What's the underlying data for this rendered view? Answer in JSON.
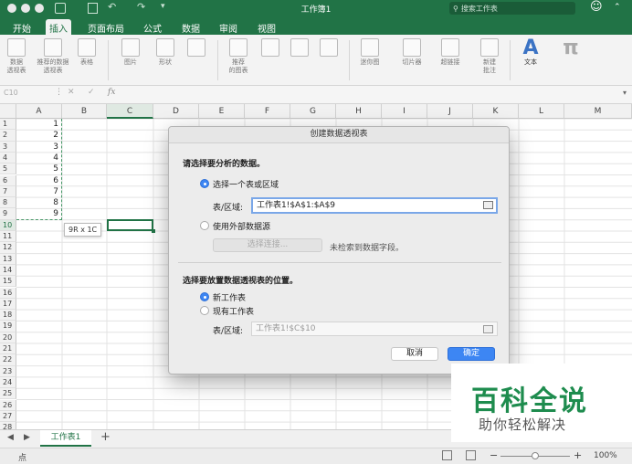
{
  "window": {
    "title": "工作簿1",
    "search_placeholder": "搜索工作表",
    "emoji": "☺"
  },
  "tabs": [
    "开始",
    "插入",
    "页面布局",
    "公式",
    "数据",
    "审阅",
    "视图"
  ],
  "ribbon": {
    "items": [
      {
        "label": "数据\n透视表",
        "icon": "pivot-table-icon"
      },
      {
        "label": "推荐的数据\n透视表",
        "icon": "recommended-pivot-icon"
      },
      {
        "label": "表格",
        "icon": "table-icon"
      },
      {
        "label": "图片",
        "icon": "picture-icon"
      },
      {
        "label": "形状",
        "icon": "shapes-icon"
      },
      {
        "label": "推荐\n的图表",
        "icon": "recommended-chart-icon"
      },
      {
        "label": "迷你图",
        "icon": "sparkline-icon"
      },
      {
        "label": "切片器",
        "icon": "slicer-icon"
      },
      {
        "label": "超链接",
        "icon": "hyperlink-icon"
      },
      {
        "label": "新建\n批注",
        "icon": "new-comment-icon"
      },
      {
        "label": "文本",
        "icon": "text-icon",
        "glyph": "A"
      },
      {
        "label": "",
        "icon": "symbol-icon",
        "glyph": "π"
      }
    ]
  },
  "formula_bar": {
    "name_box": "C10",
    "fx": "fx"
  },
  "columns": [
    "A",
    "B",
    "C",
    "D",
    "E",
    "F",
    "G",
    "H",
    "I",
    "J",
    "K",
    "L",
    "M"
  ],
  "rows": [
    "1",
    "2",
    "3",
    "4",
    "5",
    "6",
    "7",
    "8",
    "9",
    "10",
    "11",
    "12",
    "13",
    "14",
    "15",
    "16",
    "17",
    "18",
    "19",
    "20",
    "21",
    "22",
    "23",
    "24",
    "25",
    "26",
    "27",
    "28"
  ],
  "cells_A": [
    "1",
    "2",
    "3",
    "4",
    "5",
    "6",
    "7",
    "8",
    "9"
  ],
  "selection_tooltip": "9R x 1C",
  "dialog": {
    "title": "创建数据透视表",
    "section1": "请选择要分析的数据。",
    "opt_range": "选择一个表或区域",
    "range_label": "表/区域:",
    "range_value": "工作表1!$A$1:$A$9",
    "opt_external": "使用外部数据源",
    "choose_conn": "选择连接...",
    "no_fields": "未检索到数据字段。",
    "section2": "选择要放置数据透视表的位置。",
    "opt_new": "新工作表",
    "opt_existing": "现有工作表",
    "dest_label": "表/区域:",
    "dest_value": "工作表1!$C$10",
    "cancel": "取消",
    "ok": "确定"
  },
  "sheet_tab": "工作表1",
  "status": {
    "mode": "点",
    "zoom": "100%"
  },
  "watermark": {
    "title": "百科全说",
    "subtitle": "助你轻松解决"
  }
}
